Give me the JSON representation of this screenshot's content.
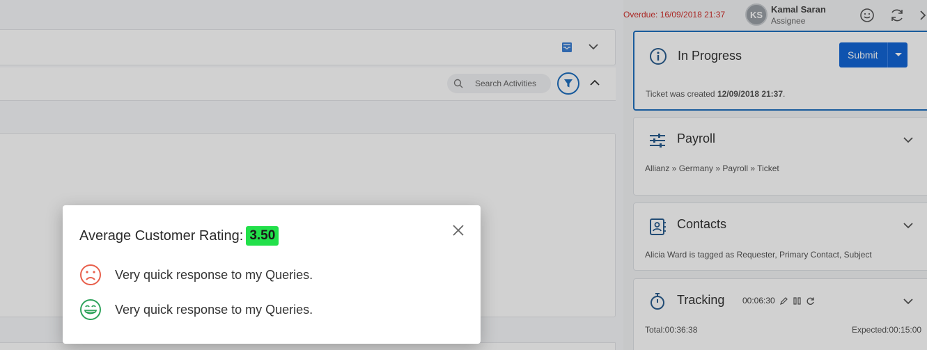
{
  "header": {
    "overdue": "Overdue: 16/09/2018 21:37",
    "avatar_initials": "KS",
    "user_name": "Kamal Saran",
    "user_role": "Assignee"
  },
  "activities": {
    "search_placeholder": "Search Activities"
  },
  "status_card": {
    "title": "In Progress",
    "submit_label": "Submit",
    "created_prefix": "Ticket was created ",
    "created_date": "12/09/2018 21:37",
    "created_suffix": "."
  },
  "category_card": {
    "title": "Payroll",
    "breadcrumb": "Allianz » Germany » Payroll » Ticket"
  },
  "contacts_card": {
    "title": "Contacts",
    "subtitle": "Alicia Ward is tagged as Requester, Primary Contact, Subject"
  },
  "tracking_card": {
    "title": "Tracking",
    "timer": "00:06:30",
    "total": "Total:00:36:38",
    "expected": "Expected:00:15:00"
  },
  "rating_modal": {
    "title": "Average Customer Rating:",
    "rating": "3.50",
    "feedback": [
      {
        "icon": "sad-face-icon",
        "text": "Very quick response to my Queries."
      },
      {
        "icon": "happy-face-icon",
        "text": "Very quick response to my Queries."
      }
    ]
  },
  "colors": {
    "accent": "#1366d6",
    "overdue": "#d0312d",
    "rating_badge": "#22e04a",
    "sad": "#e8604c",
    "happy": "#2fa35b"
  }
}
